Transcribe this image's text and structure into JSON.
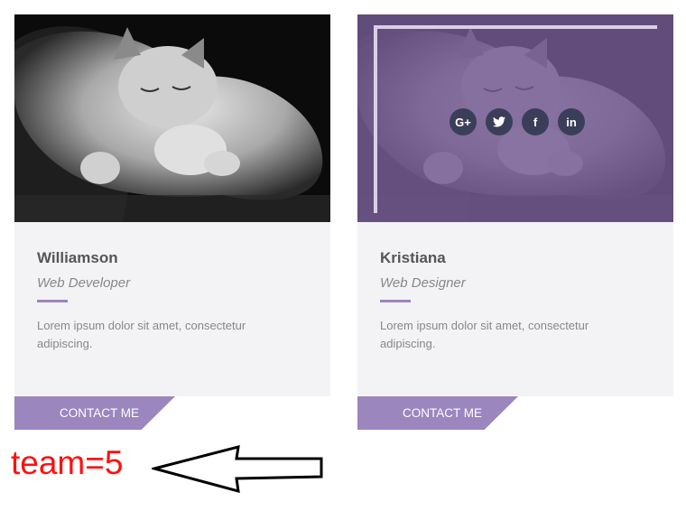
{
  "team": [
    {
      "name": "Williamson",
      "role": "Web Developer",
      "description": "Lorem ipsum dolor sit amet, consectetur adipiscing.",
      "button_label": "CONTACT ME",
      "hovered": false
    },
    {
      "name": "Kristiana",
      "role": "Web Designer",
      "description": "Lorem ipsum dolor sit amet, consectetur adipiscing.",
      "button_label": "CONTACT ME",
      "hovered": true,
      "social_icons": [
        {
          "icon": "google-plus-icon",
          "glyph": "G+"
        },
        {
          "icon": "twitter-icon",
          "glyph": "t"
        },
        {
          "icon": "facebook-icon",
          "glyph": "f"
        },
        {
          "icon": "linkedin-icon",
          "glyph": "in"
        }
      ]
    }
  ],
  "annotation": {
    "text": "team=5",
    "color": "#ff1010"
  },
  "colors": {
    "accent": "#9b86be",
    "overlay": "#745a94",
    "social_bg": "#3b3e59",
    "card_bg": "#f3f3f5"
  }
}
